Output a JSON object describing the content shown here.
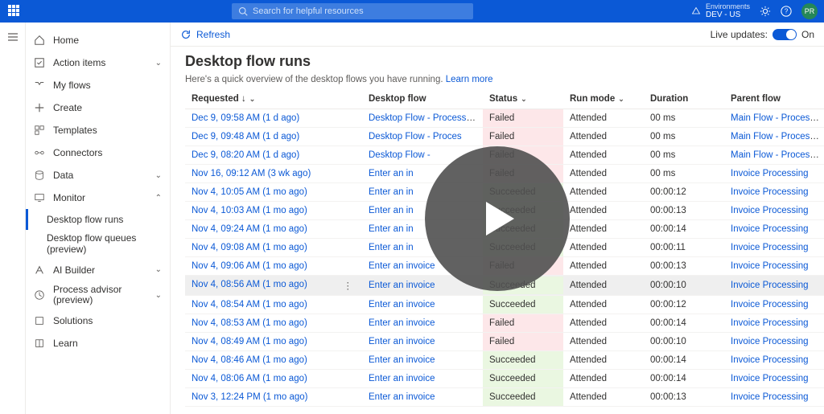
{
  "search_placeholder": "Search for helpful resources",
  "env_label": "Environments",
  "env_name": "DEV - US",
  "avatar_initials": "PR",
  "refresh_label": "Refresh",
  "live_updates_label": "Live updates:",
  "live_updates_state": "On",
  "page_title": "Desktop flow runs",
  "page_subtitle": "Here's a quick overview of the desktop flows you have running.",
  "learn_more": "Learn more",
  "nav": {
    "home": "Home",
    "action_items": "Action items",
    "my_flows": "My flows",
    "create": "Create",
    "templates": "Templates",
    "connectors": "Connectors",
    "data": "Data",
    "monitor": "Monitor",
    "monitor_sub1": "Desktop flow runs",
    "monitor_sub2": "Desktop flow queues (preview)",
    "ai_builder": "AI Builder",
    "process_advisor": "Process advisor (preview)",
    "solutions": "Solutions",
    "learn": "Learn"
  },
  "columns": {
    "requested": "Requested",
    "desktop_flow": "Desktop flow",
    "status": "Status",
    "run_mode": "Run mode",
    "duration": "Duration",
    "parent_flow": "Parent flow"
  },
  "rows": [
    {
      "requested": "Dec 9, 09:58 AM (1 d ago)",
      "flow": "Desktop Flow - Process Vendor Invoices",
      "status": "Failed",
      "mode": "Attended",
      "duration": "00 ms",
      "parent": "Main Flow - Process AI Builder Docu..."
    },
    {
      "requested": "Dec 9, 09:48 AM (1 d ago)",
      "flow": "Desktop Flow - Proces",
      "status": "Failed",
      "mode": "Attended",
      "duration": "00 ms",
      "parent": "Main Flow - Process AI Builder Docu..."
    },
    {
      "requested": "Dec 9, 08:20 AM (1 d ago)",
      "flow": "Desktop Flow -",
      "status": "Failed",
      "mode": "Attended",
      "duration": "00 ms",
      "parent": "Main Flow - Process AI Builder Docu..."
    },
    {
      "requested": "Nov 16, 09:12 AM (3 wk ago)",
      "flow": "Enter an in",
      "status": "Failed",
      "mode": "Attended",
      "duration": "00 ms",
      "parent": "Invoice Processing"
    },
    {
      "requested": "Nov 4, 10:05 AM (1 mo ago)",
      "flow": "Enter an in",
      "status": "Succeeded",
      "mode": "Attended",
      "duration": "00:00:12",
      "parent": "Invoice Processing"
    },
    {
      "requested": "Nov 4, 10:03 AM (1 mo ago)",
      "flow": "Enter an in",
      "status": "Succeeded",
      "mode": "Attended",
      "duration": "00:00:13",
      "parent": "Invoice Processing"
    },
    {
      "requested": "Nov 4, 09:24 AM (1 mo ago)",
      "flow": "Enter an in",
      "status": "Succeeded",
      "mode": "Attended",
      "duration": "00:00:14",
      "parent": "Invoice Processing"
    },
    {
      "requested": "Nov 4, 09:08 AM (1 mo ago)",
      "flow": "Enter an in",
      "status": "Succeeded",
      "mode": "Attended",
      "duration": "00:00:11",
      "parent": "Invoice Processing"
    },
    {
      "requested": "Nov 4, 09:06 AM (1 mo ago)",
      "flow": "Enter an invoice",
      "status": "Failed",
      "mode": "Attended",
      "duration": "00:00:13",
      "parent": "Invoice Processing"
    },
    {
      "requested": "Nov 4, 08:56 AM (1 mo ago)",
      "flow": "Enter an invoice",
      "status": "Succeeded",
      "mode": "Attended",
      "duration": "00:00:10",
      "parent": "Invoice Processing",
      "hovered": true
    },
    {
      "requested": "Nov 4, 08:54 AM (1 mo ago)",
      "flow": "Enter an invoice",
      "status": "Succeeded",
      "mode": "Attended",
      "duration": "00:00:12",
      "parent": "Invoice Processing"
    },
    {
      "requested": "Nov 4, 08:53 AM (1 mo ago)",
      "flow": "Enter an invoice",
      "status": "Failed",
      "mode": "Attended",
      "duration": "00:00:14",
      "parent": "Invoice Processing"
    },
    {
      "requested": "Nov 4, 08:49 AM (1 mo ago)",
      "flow": "Enter an invoice",
      "status": "Failed",
      "mode": "Attended",
      "duration": "00:00:10",
      "parent": "Invoice Processing"
    },
    {
      "requested": "Nov 4, 08:46 AM (1 mo ago)",
      "flow": "Enter an invoice",
      "status": "Succeeded",
      "mode": "Attended",
      "duration": "00:00:14",
      "parent": "Invoice Processing"
    },
    {
      "requested": "Nov 4, 08:06 AM (1 mo ago)",
      "flow": "Enter an invoice",
      "status": "Succeeded",
      "mode": "Attended",
      "duration": "00:00:14",
      "parent": "Invoice Processing"
    },
    {
      "requested": "Nov 3, 12:24 PM (1 mo ago)",
      "flow": "Enter an invoice",
      "status": "Succeeded",
      "mode": "Attended",
      "duration": "00:00:13",
      "parent": "Invoice Processing"
    }
  ]
}
